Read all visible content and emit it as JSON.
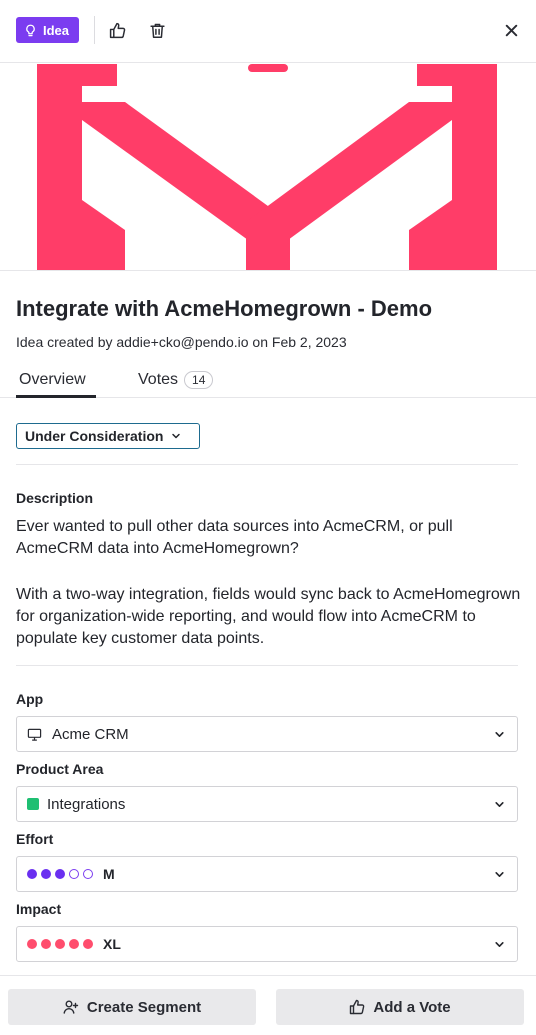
{
  "header": {
    "badge_label": "Idea",
    "badge_icon": "lightbulb-icon",
    "accent_color": "#7b3cf0",
    "icons": [
      "thumbs-up-icon",
      "trash-icon",
      "close-icon"
    ]
  },
  "hero": {
    "logo_color": "#ff3d68"
  },
  "idea": {
    "title": "Integrate with AcmeHomegrown - Demo",
    "subtitle": "Idea created by addie+cko@pendo.io on Feb 2, 2023"
  },
  "tabs": [
    {
      "label": "Overview",
      "active": true
    },
    {
      "label": "Votes",
      "count": "14",
      "active": false
    }
  ],
  "status": {
    "value": "Under Consideration"
  },
  "description": {
    "label": "Description",
    "paragraphs": [
      "Ever wanted to pull other data sources into AcmeCRM, or pull AcmeCRM data into AcmeHomegrown?",
      "With a two-way integration, fields would sync back to AcmeHomegrown for organization-wide reporting, and would flow into AcmeCRM to populate key customer data points."
    ]
  },
  "fields": {
    "app": {
      "label": "App",
      "value": "Acme CRM",
      "icon": "monitor-icon"
    },
    "product_area": {
      "label": "Product Area",
      "value": "Integrations",
      "color": "#1fbf72"
    },
    "effort": {
      "label": "Effort",
      "value": "M",
      "filled": 3,
      "total": 5,
      "color": "#6a2ff0"
    },
    "impact": {
      "label": "Impact",
      "value": "XL",
      "filled": 5,
      "total": 5,
      "color": "#ff4d6d"
    }
  },
  "footer": {
    "create_segment_label": "Create Segment",
    "add_vote_label": "Add a Vote"
  }
}
